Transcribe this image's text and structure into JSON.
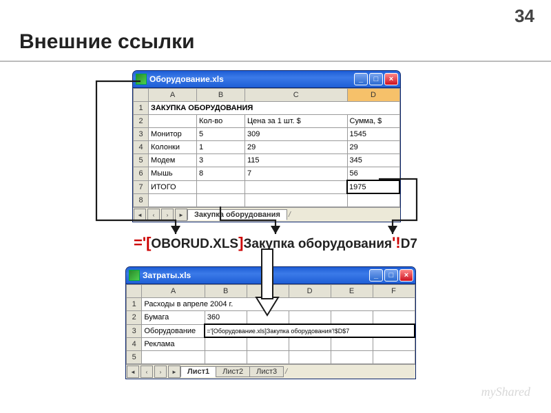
{
  "slide": {
    "number": "34",
    "title": "Внешние ссылки"
  },
  "win1": {
    "title": "Оборудование.xls",
    "cols": [
      "A",
      "B",
      "C",
      "D"
    ],
    "header_text": "ЗАКУПКА ОБОРУДОВАНИЯ",
    "row2": {
      "b": "Кол-во",
      "c": "Цена за 1 шт. $",
      "d": "Сумма, $"
    },
    "rows": [
      {
        "n": "3",
        "a": "Монитор",
        "b": "5",
        "c": "309",
        "d": "1545"
      },
      {
        "n": "4",
        "a": "Колонки",
        "b": "1",
        "c": "29",
        "d": "29"
      },
      {
        "n": "5",
        "a": "Модем",
        "b": "3",
        "c": "115",
        "d": "345"
      },
      {
        "n": "6",
        "a": "Мышь",
        "b": "8",
        "c": "7",
        "d": "56"
      },
      {
        "n": "7",
        "a": "ИТОГО",
        "b": "",
        "c": "",
        "d": "1975",
        "sel": true
      }
    ],
    "row8": {
      "n": "8"
    },
    "sheet_active": "Закупка оборудования"
  },
  "formula": {
    "eq": "=",
    "q1": "'",
    "br1": "[",
    "file": "OBORUD.XLS",
    "br2": "]",
    "sheet": "Закупка оборудования",
    "q2": "'",
    "excl": "!",
    "cell": "D7"
  },
  "win2": {
    "title": "Затраты.xls",
    "cols": [
      "A",
      "B",
      "C",
      "D",
      "E",
      "F"
    ],
    "row1_text": "Расходы в апреле 2004 г.",
    "row2": {
      "n": "2",
      "a": "Бумага",
      "b": "360"
    },
    "row3": {
      "n": "3",
      "a": "Оборудование",
      "formula": "='[Оборудование.xls]Закупка оборудования'!$D$7"
    },
    "row4": {
      "n": "4",
      "a": "Реклама"
    },
    "row5": {
      "n": "5"
    },
    "sheets": [
      "Лист1",
      "Лист2",
      "Лист3"
    ]
  },
  "watermark": "myShared"
}
